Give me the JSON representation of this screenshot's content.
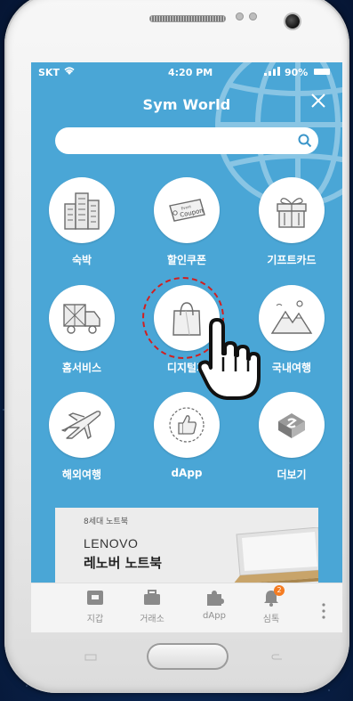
{
  "statusbar": {
    "carrier": "SKT",
    "time": "4:20 PM",
    "battery": "90%"
  },
  "header": {
    "title": "Sym World"
  },
  "search": {
    "placeholder": "",
    "value": ""
  },
  "grid": [
    {
      "label": "숙박",
      "icon": "building-icon"
    },
    {
      "label": "할인쿠폰",
      "icon": "coupon-icon",
      "icon_text_top": "Event",
      "icon_text": "Coupon"
    },
    {
      "label": "기프트카드",
      "icon": "gift-box-icon"
    },
    {
      "label": "홈서비스",
      "icon": "delivery-truck-icon"
    },
    {
      "label": "디지털가",
      "icon": "shopping-bag-icon"
    },
    {
      "label": "국내여행",
      "icon": "mountain-icon"
    },
    {
      "label": "해외여행",
      "icon": "airplane-icon"
    },
    {
      "label": "dApp",
      "icon": "thumbs-up-icon"
    },
    {
      "label": "더보기",
      "icon": "brand-logo-icon"
    }
  ],
  "banner": {
    "subtitle": "8세대 노트북",
    "brand": "LENOVO",
    "product": "레노버 노트북"
  },
  "tabbar": {
    "items": [
      {
        "label": "지갑",
        "icon": "wallet-icon"
      },
      {
        "label": "거래소",
        "icon": "briefcase-icon"
      },
      {
        "label": "dApp",
        "icon": "puzzle-icon"
      },
      {
        "label": "심톡",
        "icon": "bell-icon",
        "badge": "2"
      }
    ]
  },
  "colors": {
    "app_background": "#4aa6d6",
    "highlight_ring": "#d21f1f",
    "badge": "#f57c22"
  }
}
